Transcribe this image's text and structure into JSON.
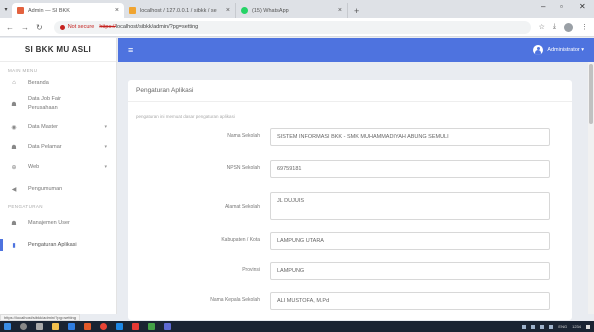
{
  "browser": {
    "tabs": [
      {
        "title": "Admin — SI BKK",
        "favicon_color": "#e3623f",
        "active": true
      },
      {
        "title": "localhost / 127.0.0.1 / sibkk / se",
        "favicon_color": "#f0a430",
        "active": false
      },
      {
        "title": "(15) WhatsApp",
        "favicon_color": "#25d366",
        "active": false
      }
    ],
    "new_tab_label": "+",
    "not_secure_label": "Not secure",
    "url_protocol": "https://",
    "url_rest": "localhost/sibkk/admin/?pg=setting",
    "status_url": "https://localhost/sibkk/admin/?pg=setting"
  },
  "sidebar": {
    "brand": "SI BKK MU ASLI",
    "heading_main": "MAIN MENU",
    "heading_pengaturan": "PENGATURAN",
    "items": [
      {
        "label": "Beranda",
        "icon": "home-icon",
        "glyph": "⌂",
        "has_children": false
      },
      {
        "label": "Data Job Fair Perusahaan",
        "icon": "users-icon",
        "glyph": "☗",
        "has_children": false
      },
      {
        "label": "Data Master",
        "icon": "database-icon",
        "glyph": "◉",
        "has_children": true
      },
      {
        "label": "Data Pelamar",
        "icon": "user-group-icon",
        "glyph": "☗",
        "has_children": true
      },
      {
        "label": "Web",
        "icon": "globe-icon",
        "glyph": "⊕",
        "has_children": true
      },
      {
        "label": "Pengumuman",
        "icon": "megaphone-icon",
        "glyph": "◀",
        "has_children": false
      },
      {
        "label": "Manajemen User",
        "icon": "user-manage-icon",
        "glyph": "☗",
        "has_children": false
      },
      {
        "label": "Pengaturan Aplikasi",
        "icon": "settings-icon",
        "glyph": "▮",
        "has_children": false,
        "active": true
      }
    ]
  },
  "header": {
    "admin_label": "Administrator ▾"
  },
  "card": {
    "title": "Pengaturan Aplikasi",
    "description": "pengaturan ini memuat dasar pengaturan aplikasi",
    "fields": [
      {
        "label": "Nama Sekolah",
        "value": "SISTEM INFORMASI BKK - SMK MUHAMMADIYAH ABUNG SEMULI"
      },
      {
        "label": "NPSN Sekolah",
        "value": "69759181"
      },
      {
        "label": "Alamat Sekolah",
        "value": "JL DUJUIS"
      },
      {
        "label": "Kabupaten / Kota",
        "value": "LAMPUNG UTARA"
      },
      {
        "label": "Provinsi",
        "value": "LAMPUNG"
      },
      {
        "label": "Nama Kepala Sekolah",
        "value": "ALI MUSTOFA, M.Pd"
      }
    ]
  },
  "taskbar": {
    "time": "1234",
    "lang": "ENG"
  },
  "colors": {
    "accent": "#4e73df"
  }
}
